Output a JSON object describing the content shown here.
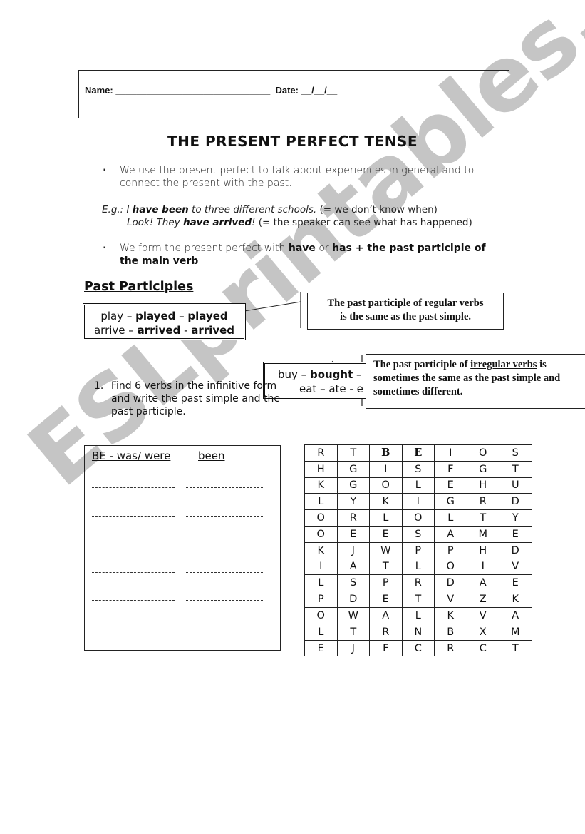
{
  "header": {
    "name_label": "Name:",
    "name_blank": " ______________________________",
    "date_label": "  Date:",
    "date_blank": " __/__/__"
  },
  "title": "THE PRESENT PERFECT TENSE",
  "bullets": [
    {
      "marker": "▪",
      "text": "We use the present perfect to talk about experiences in general and to connect the present with the past."
    }
  ],
  "examples": {
    "line1": {
      "prefix": "E.g.: I ",
      "bold": "have been",
      "mid": " to three different schools.",
      "note": " (= we don’t know when)"
    },
    "line2": {
      "prefix": "Look! They ",
      "bold": "have arrived",
      "mid": "!",
      "note": "  (= the speaker can see what has happened)"
    }
  },
  "bullet2": {
    "marker": "▪",
    "t1": "We form the present perfect with ",
    "b1": "have",
    "t2": " or ",
    "b2": "has + the past participle of the main verb",
    "t3": "."
  },
  "section_heading": "Past Participles",
  "regular_box": {
    "line1_a": "play – ",
    "line1_b": "played",
    "line1_c": " – ",
    "line1_d": "played",
    "line2_a": "arrive – ",
    "line2_b": "arrived",
    "line2_c": " - ",
    "line2_d": "arrived"
  },
  "regular_callout": {
    "t1": "The past participle of ",
    "u": "regular verbs",
    "t2": "is the same as the past simple."
  },
  "irregular_box": {
    "line1_a": "buy – ",
    "line1_b": "bought",
    "line1_c": " –",
    "line2": "eat – ate - e"
  },
  "irregular_callout": {
    "t1": "The past participle of ",
    "u": "irregular verbs",
    "t2": " is sometimes the same as the past simple and sometimes different."
  },
  "task": {
    "number": "1.",
    "text": "Find 6 verbs in the infinitive form and write the past simple and the past participle."
  },
  "answer_box": {
    "col1_header": "BE - was/ were",
    "col2_header": "been",
    "blank_rows": 6
  },
  "word_search": {
    "grid": [
      [
        "R",
        "T",
        "B",
        "E",
        "I",
        "O",
        "S"
      ],
      [
        "H",
        "G",
        "I",
        "S",
        "F",
        "G",
        "T"
      ],
      [
        "K",
        "G",
        "O",
        "L",
        "E",
        "H",
        "U"
      ],
      [
        "L",
        "Y",
        "K",
        "I",
        "G",
        "R",
        "D"
      ],
      [
        "O",
        "R",
        "L",
        "O",
        "L",
        "T",
        "Y"
      ],
      [
        "O",
        "E",
        "E",
        "S",
        "A",
        "M",
        "E"
      ],
      [
        "K",
        "J",
        "W",
        "P",
        "P",
        "H",
        "D"
      ],
      [
        "I",
        "A",
        "T",
        "L",
        "O",
        "I",
        "V"
      ],
      [
        "L",
        "S",
        "P",
        "R",
        "D",
        "A",
        "E"
      ],
      [
        "P",
        "D",
        "E",
        "T",
        "V",
        "Z",
        "K"
      ],
      [
        "O",
        "W",
        "A",
        "L",
        "K",
        "V",
        "A"
      ],
      [
        "L",
        "T",
        "R",
        "N",
        "B",
        "X",
        "M"
      ],
      [
        "E",
        "J",
        "F",
        "C",
        "R",
        "C",
        "T"
      ]
    ],
    "bold_cells": [
      [
        0,
        2
      ],
      [
        0,
        3
      ]
    ]
  },
  "watermark": "ESLprintables.com"
}
